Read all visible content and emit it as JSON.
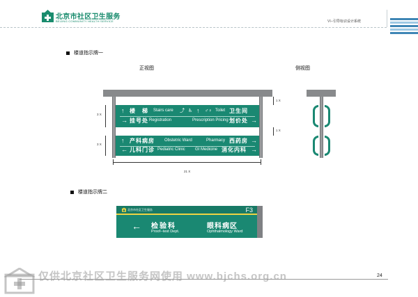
{
  "header": {
    "logo_cn": "北京市社区卫生服务",
    "logo_en": "BEIJING COMMUNITY HEALTH SERVICE",
    "doc_title": "VI--引导标识设计系统"
  },
  "section1": {
    "title": "楼道指示牌一",
    "front_label": "正视图",
    "side_label": "侧视图"
  },
  "front_sign": {
    "panel1": {
      "top_left": {
        "arrow": "↑",
        "cn": "楼　梯",
        "en": "Stairs care"
      },
      "top_right": {
        "arrow": "↑",
        "en": "Toilet",
        "cn": "卫生间"
      },
      "bottom_left": {
        "arrow": "→",
        "cn": "挂号处",
        "en": "Registration"
      },
      "bottom_right": {
        "en": "Prescription Pricing",
        "cn": "划价处",
        "arrow": "→"
      }
    },
    "panel2": {
      "top_left": {
        "arrow": "↑",
        "cn": "产科病房",
        "en": "Obstetric Ward"
      },
      "top_right": {
        "en": "Pharmacy",
        "cn": "西药房",
        "arrow": "→"
      },
      "bottom_left": {
        "arrow": "←",
        "cn": "儿科门诊",
        "en": "Pediatric Clinic"
      },
      "bottom_right": {
        "en": "GI Medicine",
        "cn": "消化内科",
        "arrow": "→"
      }
    },
    "dims": {
      "height1": "3 X",
      "height2": "3 X",
      "gap_top": "1 X",
      "gap_mid": "1 X",
      "width": "21 X"
    }
  },
  "section2": {
    "title": "楼道指示牌二"
  },
  "sign2": {
    "org": "北京市社区卫生服务",
    "floor": "F3",
    "left_arrow": "←",
    "left_cn": "检验科",
    "left_en": "Proof--test Dept.",
    "right_cn": "眼科病区",
    "right_en": "Ophthalmology Ward"
  },
  "footer": {
    "page_number": "24",
    "watermark": "仅供北京社区卫生服务网使用  www.bjchs.org.cn"
  },
  "colors": {
    "brand_green": "#1a8872",
    "stripe_blue": "#3f86b5",
    "accent_yellow": "#f0d442"
  }
}
